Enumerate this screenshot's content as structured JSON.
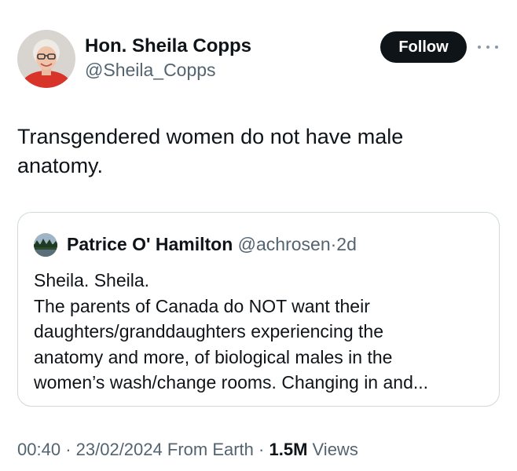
{
  "author": {
    "display_name": "Hon. Sheila Copps",
    "handle": "@Sheila_Copps"
  },
  "actions": {
    "follow_label": "Follow",
    "more_icon": "more-horizontal-icon"
  },
  "tweet": {
    "text": "Transgendered women do not have male anatomy."
  },
  "quote": {
    "display_name": "Patrice O' Hamilton",
    "handle": "@achrosen",
    "separator": "·",
    "time": "2d",
    "lines": [
      "Sheila. Sheila.",
      "The parents of Canada do NOT want their",
      "daughters/granddaughters experiencing the",
      "anatomy and more, of biological males in the",
      "women’s wash/change rooms.  Changing in and..."
    ]
  },
  "meta": {
    "time": "00:40",
    "sep1": "·",
    "date": "23/02/2024",
    "location": "From Earth",
    "sep2": "·",
    "views_count": "1.5M",
    "views_label": "Views"
  },
  "colors": {
    "text_primary": "#0f1419",
    "text_secondary": "#536471",
    "border": "#cfd9de",
    "follow_bg": "#0f1419",
    "avatar_bg": "#e03a2f"
  }
}
